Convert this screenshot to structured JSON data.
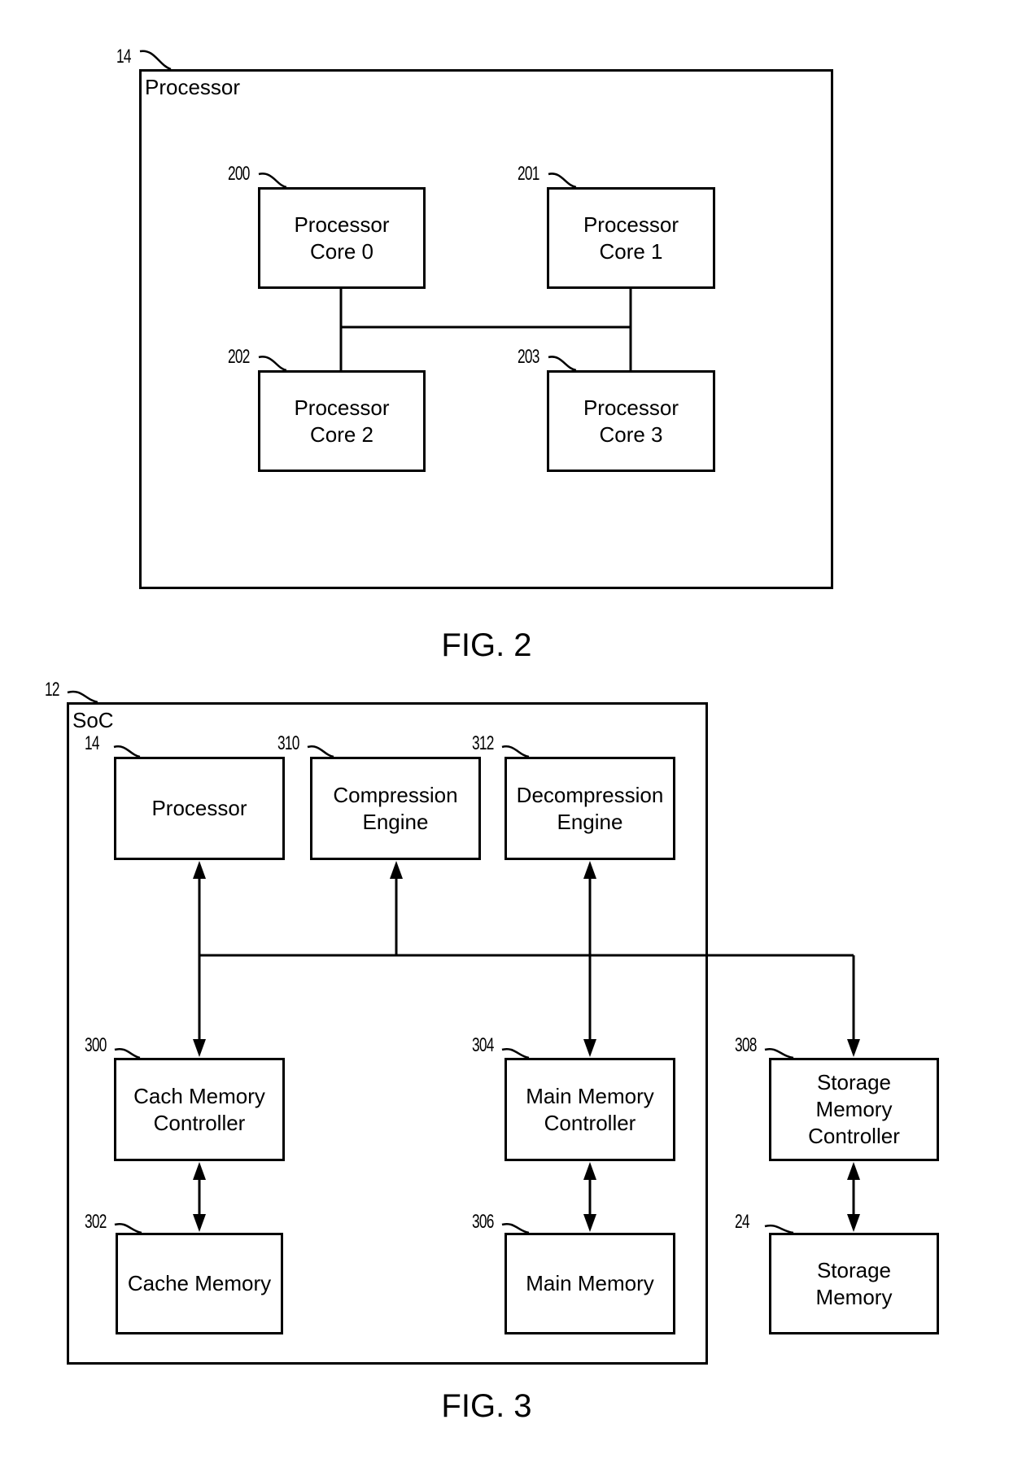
{
  "fig2": {
    "caption": "FIG. 2",
    "processor": {
      "ref": "14",
      "label": "Processor"
    },
    "cores": [
      {
        "ref": "200",
        "label": "Processor\nCore 0"
      },
      {
        "ref": "201",
        "label": "Processor\nCore 1"
      },
      {
        "ref": "202",
        "label": "Processor\nCore 2"
      },
      {
        "ref": "203",
        "label": "Processor\nCore 3"
      }
    ]
  },
  "fig3": {
    "caption": "FIG. 3",
    "soc": {
      "ref": "12",
      "label": "SoC"
    },
    "blocks": {
      "processor": {
        "ref": "14",
        "label": "Processor"
      },
      "compression": {
        "ref": "310",
        "label": "Compression\nEngine"
      },
      "decompression": {
        "ref": "312",
        "label": "Decompression\nEngine"
      },
      "cache_ctrl": {
        "ref": "300",
        "label": "Cach Memory\nController"
      },
      "cache_mem": {
        "ref": "302",
        "label": "Cache Memory"
      },
      "main_ctrl": {
        "ref": "304",
        "label": "Main Memory\nController"
      },
      "main_mem": {
        "ref": "306",
        "label": "Main Memory"
      },
      "storage_ctrl": {
        "ref": "308",
        "label": "Storage\nMemory\nController"
      },
      "storage_mem": {
        "ref": "24",
        "label": "Storage\nMemory"
      }
    }
  }
}
